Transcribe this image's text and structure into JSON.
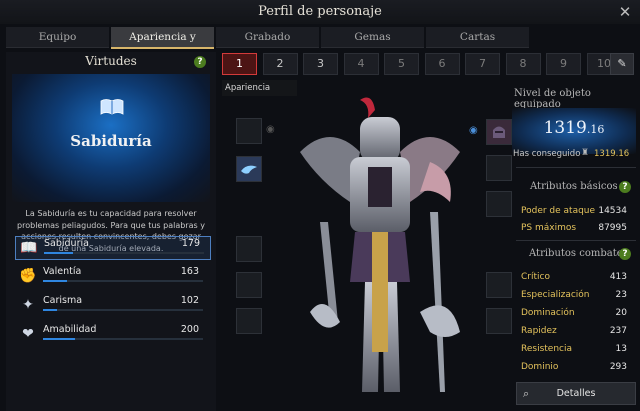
{
  "window": {
    "title": "Perfil de personaje",
    "close_icon": "close-icon"
  },
  "tabs": [
    {
      "label": "Equipo"
    },
    {
      "label": "Apariencia y virtudes"
    },
    {
      "label": "Grabado"
    },
    {
      "label": "Gemas"
    },
    {
      "label": "Cartas"
    }
  ],
  "virtues": {
    "title": "Virtudes",
    "selected_name": "Sabiduría",
    "description": "La Sabiduría es tu capacidad para resolver problemas peliagudos. Para que tus palabras y acciones resulten convincentes, debes gozar de una Sabiduría elevada.",
    "items": [
      {
        "label": "Sabiduría",
        "value": "179",
        "icon": "book-icon",
        "progress": 0.18
      },
      {
        "label": "Valentía",
        "value": "163",
        "icon": "fist-icon",
        "progress": 0.15
      },
      {
        "label": "Carisma",
        "value": "102",
        "icon": "sparkle-icon",
        "progress": 0.09
      },
      {
        "label": "Amabilidad",
        "value": "200",
        "icon": "heart-hand-icon",
        "progress": 0.2
      }
    ]
  },
  "slots": [
    "1",
    "2",
    "3",
    "4",
    "5",
    "6",
    "7",
    "8",
    "9",
    "10"
  ],
  "appearance_label": "Apariencia",
  "item_level": {
    "title": "Nivel de objeto equipado",
    "main": "1319",
    "decimal": ".16",
    "achieved_label": "Has conseguido",
    "achieved_value": "1319.16"
  },
  "basic": {
    "title": "Atributos básicos",
    "stats": [
      {
        "k": "Poder de ataque",
        "v": "14534"
      },
      {
        "k": "PS máximos",
        "v": "87995"
      }
    ]
  },
  "combat": {
    "title": "Atributos combate",
    "stats": [
      {
        "k": "Crítico",
        "v": "413"
      },
      {
        "k": "Especialización",
        "v": "23"
      },
      {
        "k": "Dominación",
        "v": "20"
      },
      {
        "k": "Rapidez",
        "v": "237"
      },
      {
        "k": "Resistencia",
        "v": "13"
      },
      {
        "k": "Dominio",
        "v": "293"
      }
    ]
  },
  "details_label": "Detalles"
}
